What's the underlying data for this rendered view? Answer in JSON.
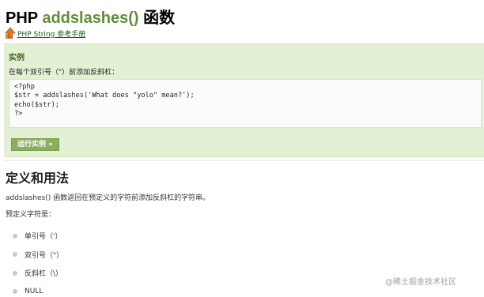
{
  "page": {
    "title_prefix": "PHP ",
    "title_function": "addslashes()",
    "title_suffix": " 函数"
  },
  "reference_link": {
    "label": "PHP String 参考手册",
    "icon": "up-arrow-icon"
  },
  "example": {
    "heading": "实例",
    "description": "在每个双引号（\"）前添加反斜杠：",
    "code_lines": [
      "<?php",
      "$str = addslashes('What does \"yolo\" mean?');",
      "echo($str);",
      "?>"
    ],
    "run_button_label": "运行实例 »"
  },
  "definition": {
    "heading": "定义和用法",
    "paragraph_1": "addslashes() 函数返回在预定义的字符前添加反斜杠的字符串。",
    "paragraph_2": "预定义字符是：",
    "items": [
      "单引号（'）",
      "双引号（\"）",
      "反斜杠（\\）",
      "NULL"
    ]
  },
  "watermark": "@稀土掘金技术社区",
  "colors": {
    "function_green": "#5e8f3a",
    "example_bg": "#e4f0d4",
    "run_button_bg": "#8aad5e"
  }
}
